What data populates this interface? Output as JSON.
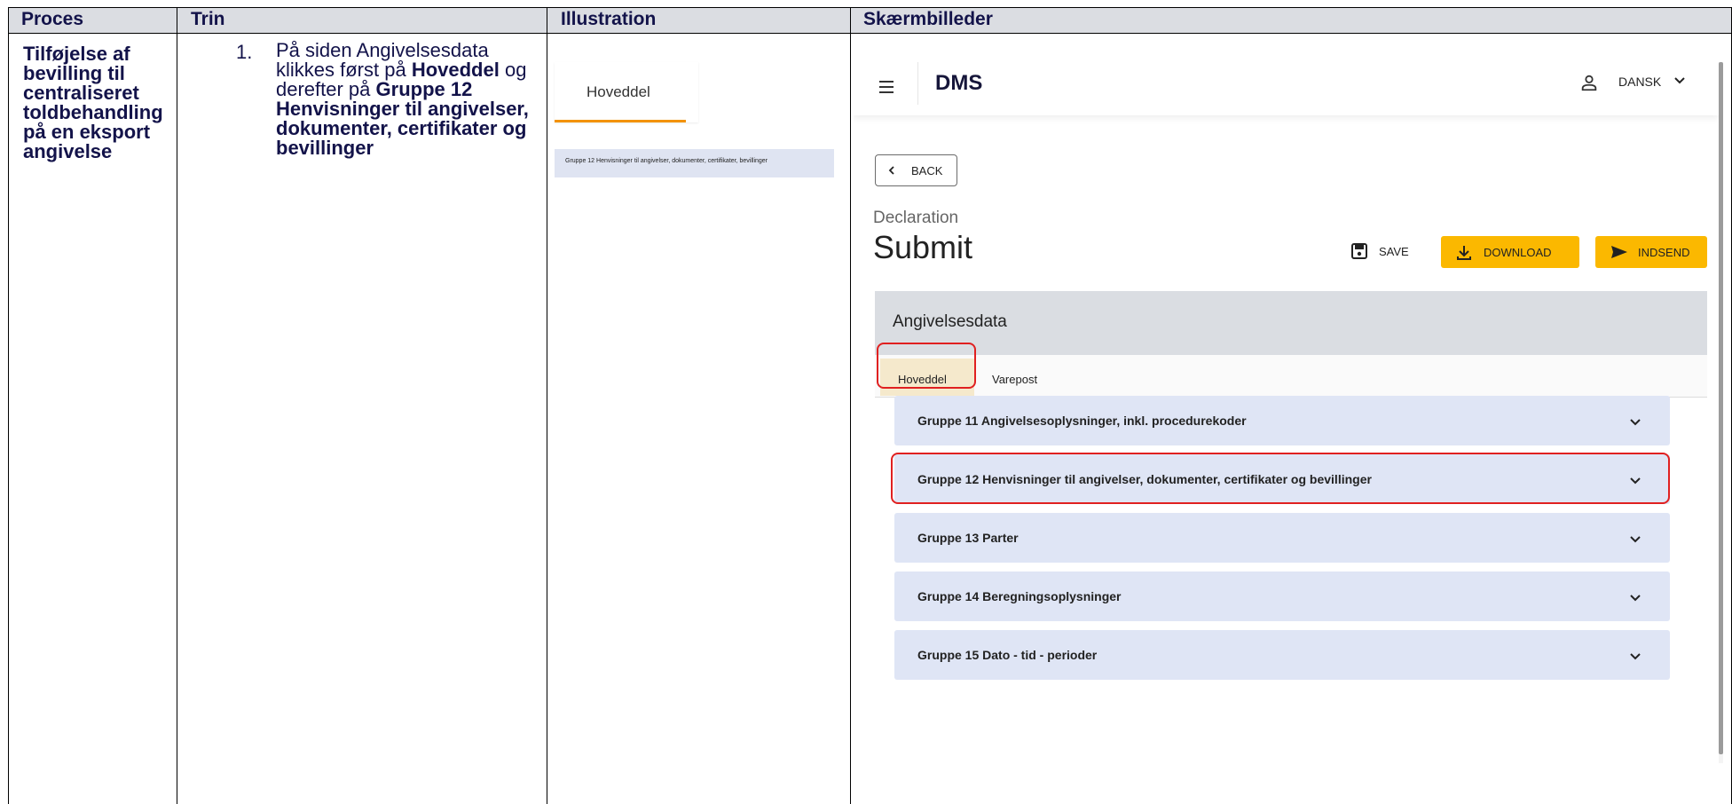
{
  "table": {
    "headers": [
      "Proces",
      "Trin",
      "Illustration",
      "Skærmbilleder"
    ],
    "proces": "Tilføjelse af bevilling til centraliseret toldbehandling på en eksport angivelse",
    "step_number": "1.",
    "step_text_1": "På siden Angivelsesdata klikkes først på ",
    "step_bold_1": "Hoveddel",
    "step_text_2": " og derefter på ",
    "step_bold_2": "Gruppe 12 Henvisninger til angivelser, dokumenter, certifikater og bevillinger"
  },
  "illustration": {
    "tab_label": "Hoveddel",
    "group_label": "Gruppe 12 Henvisninger til angivelser, dokumenter, certifikater, bevillinger"
  },
  "screenshot": {
    "app_title": "DMS",
    "language": "DANSK",
    "back_label": "BACK",
    "declaration_label": "Declaration",
    "page_title": "Submit",
    "save_label": "SAVE",
    "download_label": "DOWNLOAD",
    "send_label": "INDSEND",
    "panel_title": "Angivelsesdata",
    "tabs": [
      "Hoveddel",
      "Varepost"
    ],
    "active_tab": "Hoveddel",
    "groups": [
      "Gruppe 11 Angivelsesoplysninger, inkl. procedurekoder",
      "Gruppe 12 Henvisninger til angivelser, dokumenter, certifikater og bevillinger",
      "Gruppe 13 Parter",
      "Gruppe 14 Beregningsoplysninger",
      "Gruppe 15 Dato - tid - perioder"
    ],
    "highlighted_group": "Gruppe 12 Henvisninger til angivelser, dokumenter, certifikater og bevillinger",
    "icons": [
      "menu-icon",
      "user-icon",
      "chevron-down-icon",
      "chevron-left-icon",
      "save-icon",
      "download-icon",
      "send-icon"
    ],
    "colors": {
      "accent_yellow": "#fbb800",
      "tab_underline": "#f39200",
      "highlight_red": "#e02020",
      "group_bg": "#dfe5f5",
      "panel_header": "#dadde2"
    }
  }
}
